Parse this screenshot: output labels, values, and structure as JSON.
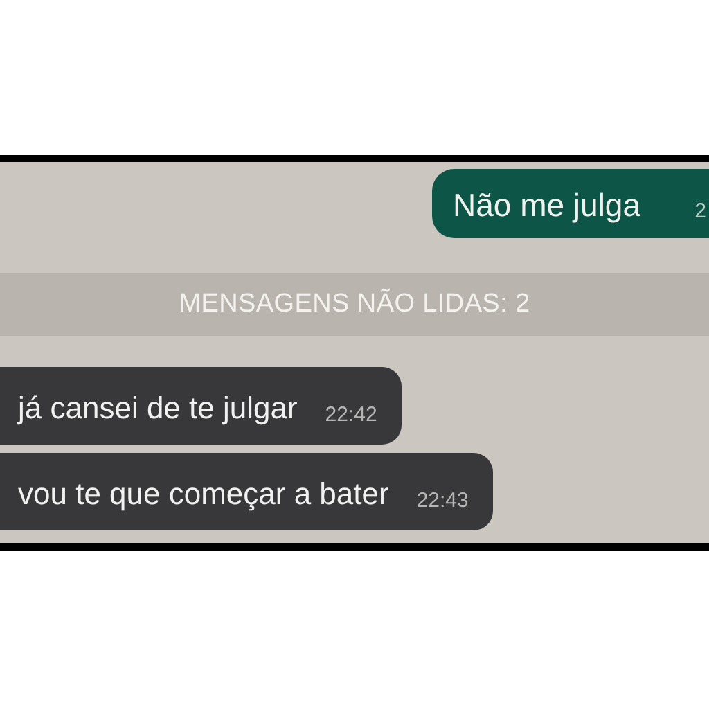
{
  "chat": {
    "items": [
      {
        "kind": "outgoing",
        "text": "Não me julga",
        "time": "2"
      },
      {
        "kind": "unread_banner",
        "text": "MENSAGENS NÃO LIDAS: 2"
      },
      {
        "kind": "incoming",
        "text": "já cansei de te julgar",
        "time": "22:42"
      },
      {
        "kind": "incoming",
        "text": "vou te que começar a bater",
        "time": "22:43"
      }
    ]
  }
}
